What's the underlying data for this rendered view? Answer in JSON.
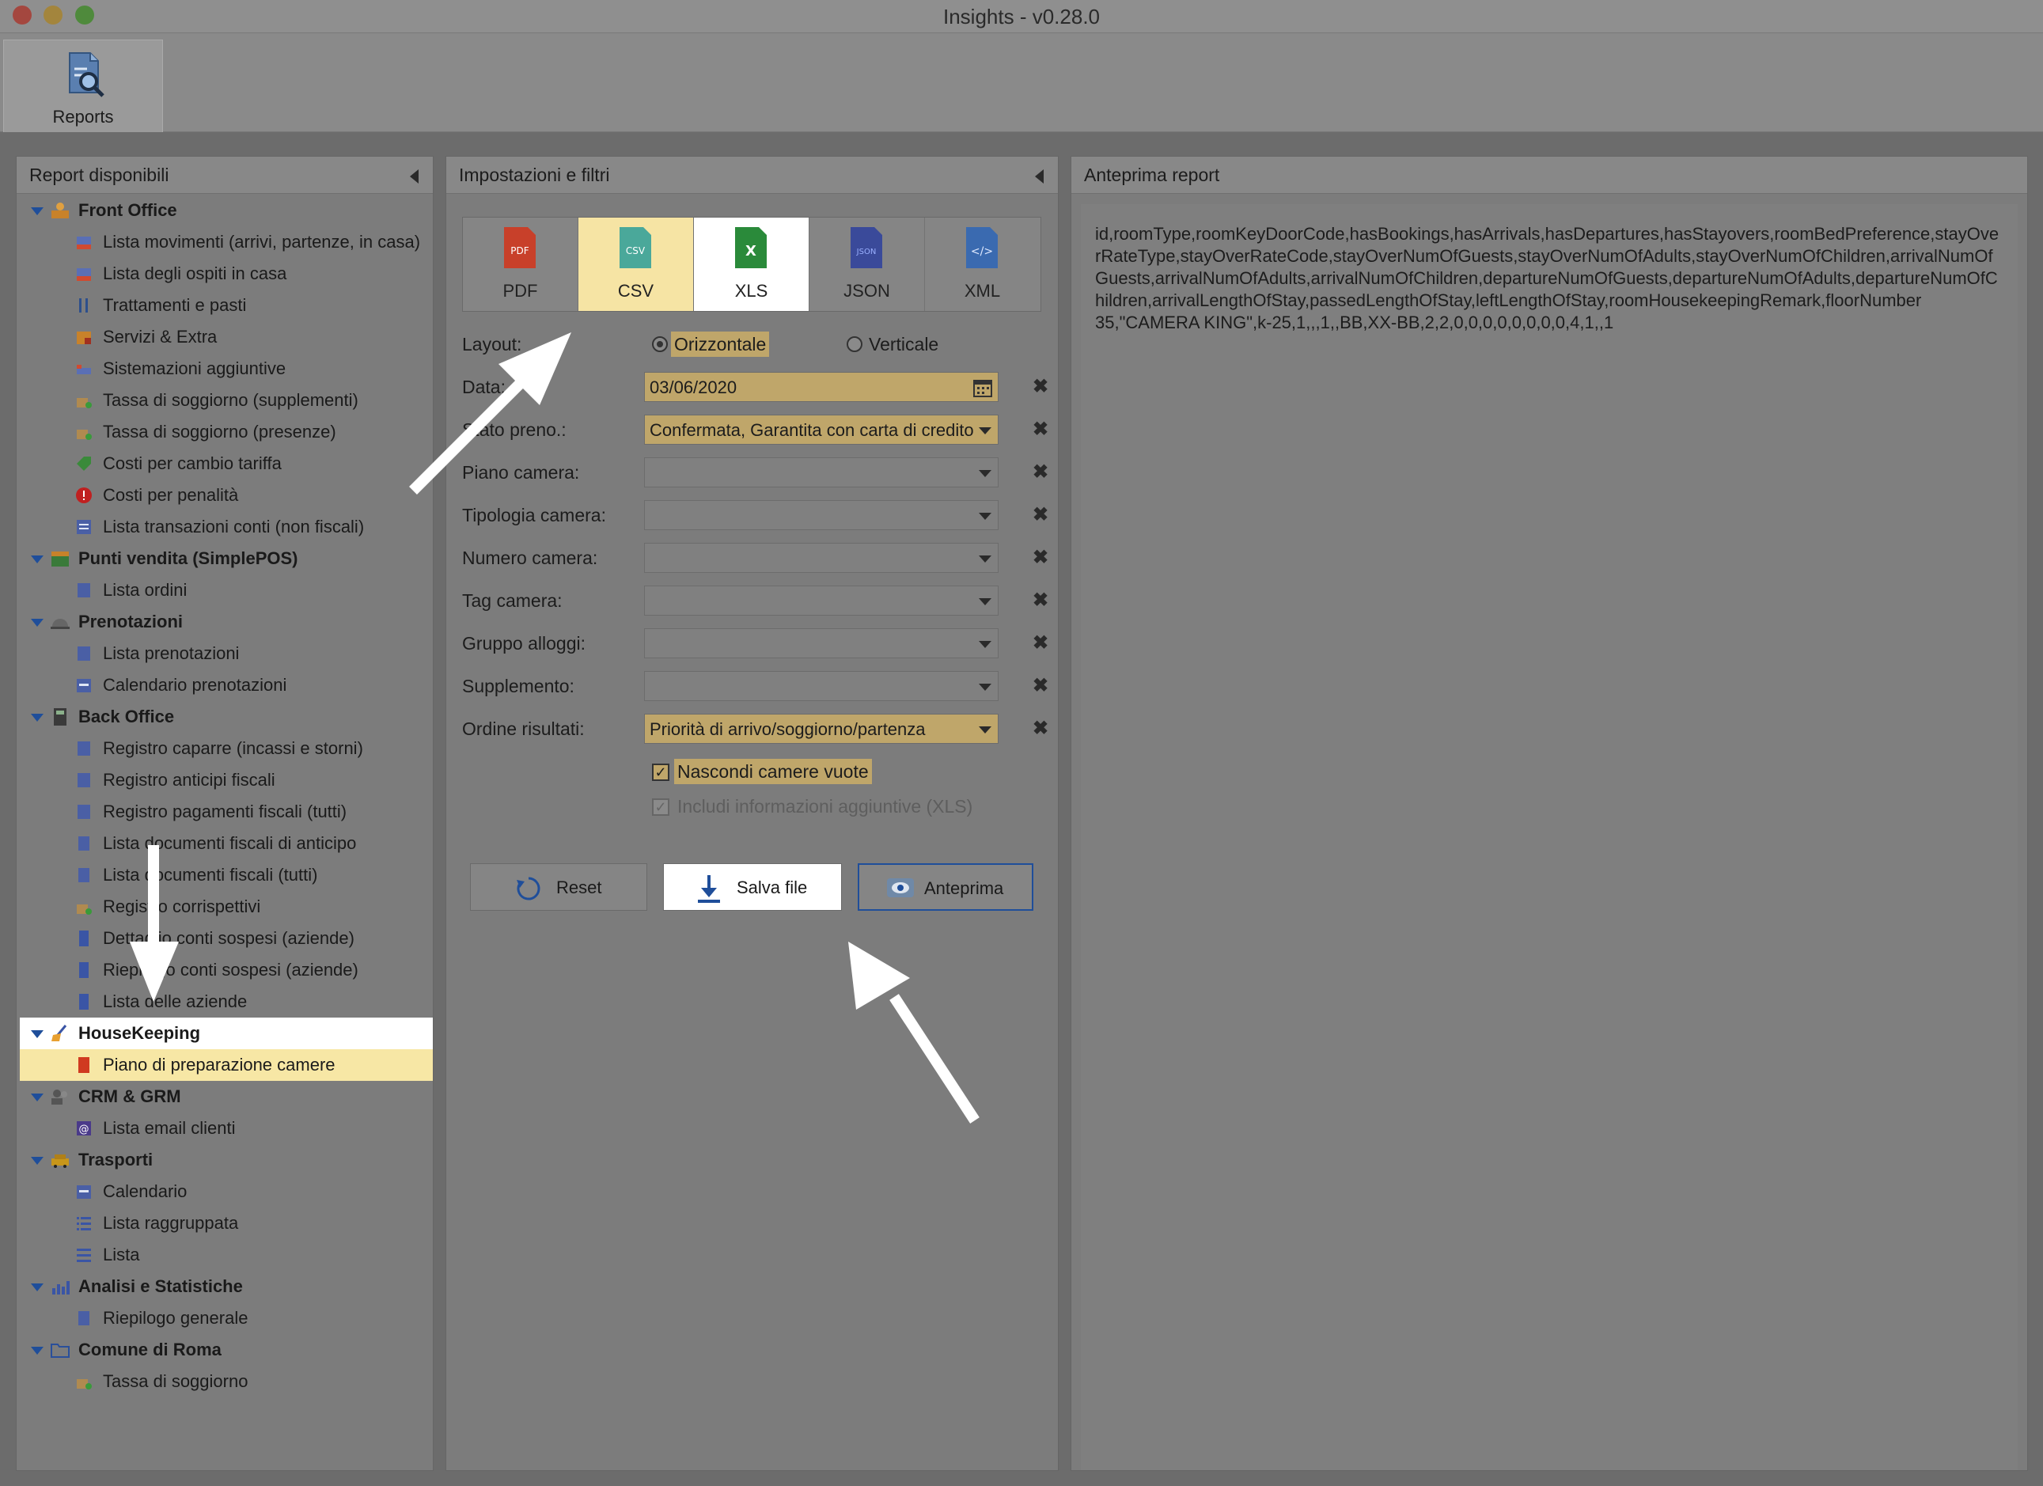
{
  "window": {
    "title": "Insights - v0.28.0"
  },
  "toolbar": {
    "reports_label": "Reports"
  },
  "left_panel": {
    "header": "Report disponibili",
    "categories": [
      {
        "label": "Front Office",
        "items": [
          "Lista movimenti (arrivi, partenze, in casa)",
          "Lista degli ospiti in casa",
          "Trattamenti e pasti",
          "Servizi & Extra",
          "Sistemazioni aggiuntive",
          "Tassa di soggiorno (supplementi)",
          "Tassa di soggiorno (presenze)",
          "Costi per cambio tariffa",
          "Costi per penalità",
          "Lista transazioni conti (non fiscali)"
        ]
      },
      {
        "label": "Punti vendita (SimplePOS)",
        "items": [
          "Lista ordini"
        ]
      },
      {
        "label": "Prenotazioni",
        "items": [
          "Lista prenotazioni",
          "Calendario prenotazioni"
        ]
      },
      {
        "label": "Back Office",
        "items": [
          "Registro caparre (incassi e storni)",
          "Registro anticipi fiscali",
          "Registro pagamenti fiscali (tutti)",
          "Lista documenti fiscali di anticipo",
          "Lista documenti fiscali (tutti)",
          "Registro corrispettivi",
          "Dettaglio conti sospesi (aziende)",
          "Riepilogo conti sospesi (aziende)",
          "Lista delle aziende"
        ]
      },
      {
        "label": "HouseKeeping",
        "items": [
          "Piano di preparazione camere"
        ]
      },
      {
        "label": "CRM & GRM",
        "items": [
          "Lista email clienti"
        ]
      },
      {
        "label": "Trasporti",
        "items": [
          "Calendario",
          "Lista raggruppata",
          "Lista"
        ]
      },
      {
        "label": "Analisi e Statistiche",
        "items": [
          "Riepilogo generale"
        ]
      },
      {
        "label": "Comune di Roma",
        "items": [
          "Tassa di soggiorno"
        ]
      }
    ]
  },
  "middle_panel": {
    "header": "Impostazioni e filtri",
    "formats": [
      "PDF",
      "CSV",
      "XLS",
      "JSON",
      "XML"
    ],
    "selected_format": "CSV",
    "layout_label": "Layout:",
    "layout_options": [
      "Orizzontale",
      "Verticale"
    ],
    "layout_selected": "Orizzontale",
    "fields": {
      "data": {
        "label": "Data:",
        "value": "03/06/2020"
      },
      "stato": {
        "label": "Stato preno.:",
        "value": "Confermata, Garantita con carta di credito"
      },
      "piano": {
        "label": "Piano camera:",
        "value": ""
      },
      "tipologia": {
        "label": "Tipologia camera:",
        "value": ""
      },
      "numero": {
        "label": "Numero camera:",
        "value": ""
      },
      "tag": {
        "label": "Tag camera:",
        "value": ""
      },
      "gruppo": {
        "label": "Gruppo alloggi:",
        "value": ""
      },
      "supplemento": {
        "label": "Supplemento:",
        "value": ""
      },
      "ordine": {
        "label": "Ordine risultati:",
        "value": "Priorità di arrivo/soggiorno/partenza"
      }
    },
    "checkboxes": {
      "nascondi": "Nascondi camere vuote",
      "includi": "Includi informazioni aggiuntive (XLS)"
    },
    "buttons": {
      "reset": "Reset",
      "save": "Salva file",
      "preview": "Anteprima"
    }
  },
  "right_panel": {
    "header": "Anteprima report",
    "preview_text": "id,roomType,roomKeyDoorCode,hasBookings,hasArrivals,hasDepartures,hasStayovers,roomBedPreference,stayOverRateType,stayOverRateCode,stayOverNumOfGuests,stayOverNumOfAdults,stayOverNumOfChildren,arrivalNumOfGuests,arrivalNumOfAdults,arrivalNumOfChildren,departureNumOfGuests,departureNumOfAdults,departureNumOfChildren,arrivalLengthOfStay,passedLengthOfStay,leftLengthOfStay,roomHousekeepingRemark,floorNumber",
    "preview_row": "35,\"CAMERA KING\",k-25,1,,,1,,BB,XX-BB,2,2,0,0,0,0,0,0,0,0,4,1,,1"
  }
}
